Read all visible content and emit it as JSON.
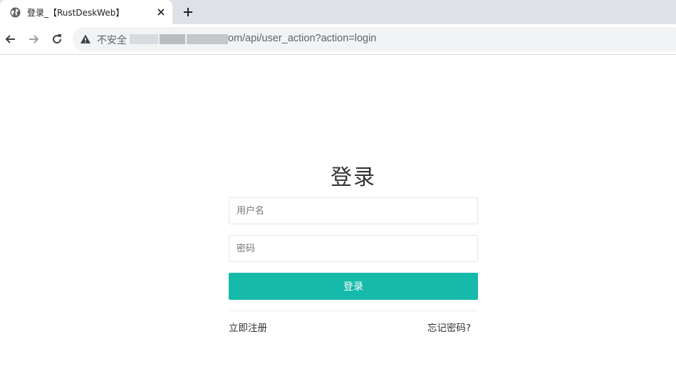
{
  "browser": {
    "tab_title": "登录_【RustDeskWeb】",
    "security_label": "不安全",
    "url_visible": "om/api/user_action?action=login"
  },
  "login": {
    "title": "登录",
    "username_placeholder": "用户名",
    "password_placeholder": "密码",
    "submit_label": "登录",
    "register_link": "立即注册",
    "forgot_link": "忘记密码?"
  },
  "colors": {
    "accent": "#16baaa",
    "chrome_bg": "#dee1e6",
    "omnibox_bg": "#f1f3f4"
  }
}
